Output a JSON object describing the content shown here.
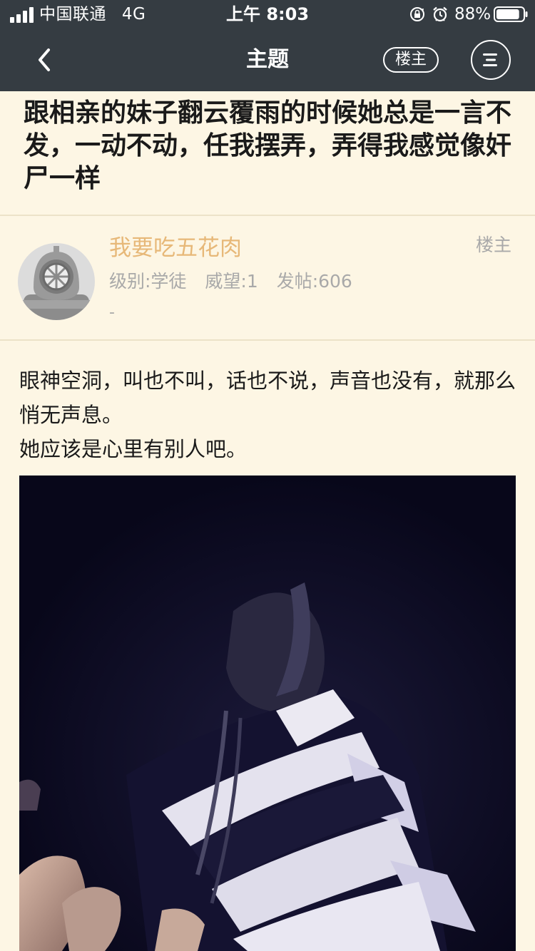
{
  "status_bar": {
    "carrier": "中国联通",
    "network": "4G",
    "time": "上午 8:03",
    "battery_percent": "88%",
    "battery_level": 0.88,
    "icons": [
      "signal-icon",
      "rotation-lock-icon",
      "alarm-icon",
      "battery-icon"
    ]
  },
  "nav": {
    "back_icon": "chevron-left-icon",
    "title": "主题",
    "owner_button_label": "楼主",
    "menu_icon": "menu-icon"
  },
  "post": {
    "title": "跟相亲的妹子翻云覆雨的时候她总是一言不发，一动不动，任我摆弄，弄得我感觉像奸尸一样",
    "author": {
      "name": "我要吃五花肉",
      "role_tag": "楼主",
      "level": "级别:学徒",
      "reputation": "威望:1",
      "posts": "发帖:606",
      "extra": "-",
      "avatar_icon": "diving-helmet-avatar"
    },
    "body": {
      "line1": "眼神空洞，叫也不叫，话也不说，声音也没有，就那么悄无声息。",
      "line2": "她应该是心里有别人吧。"
    },
    "image": "dark-photo-person-striped-sweater"
  },
  "colors": {
    "header_bg": "#353c42",
    "page_bg": "#fdf6e4",
    "author_name": "#e7b878",
    "meta_text": "#a9a9a9",
    "divider": "#ece2c8"
  }
}
